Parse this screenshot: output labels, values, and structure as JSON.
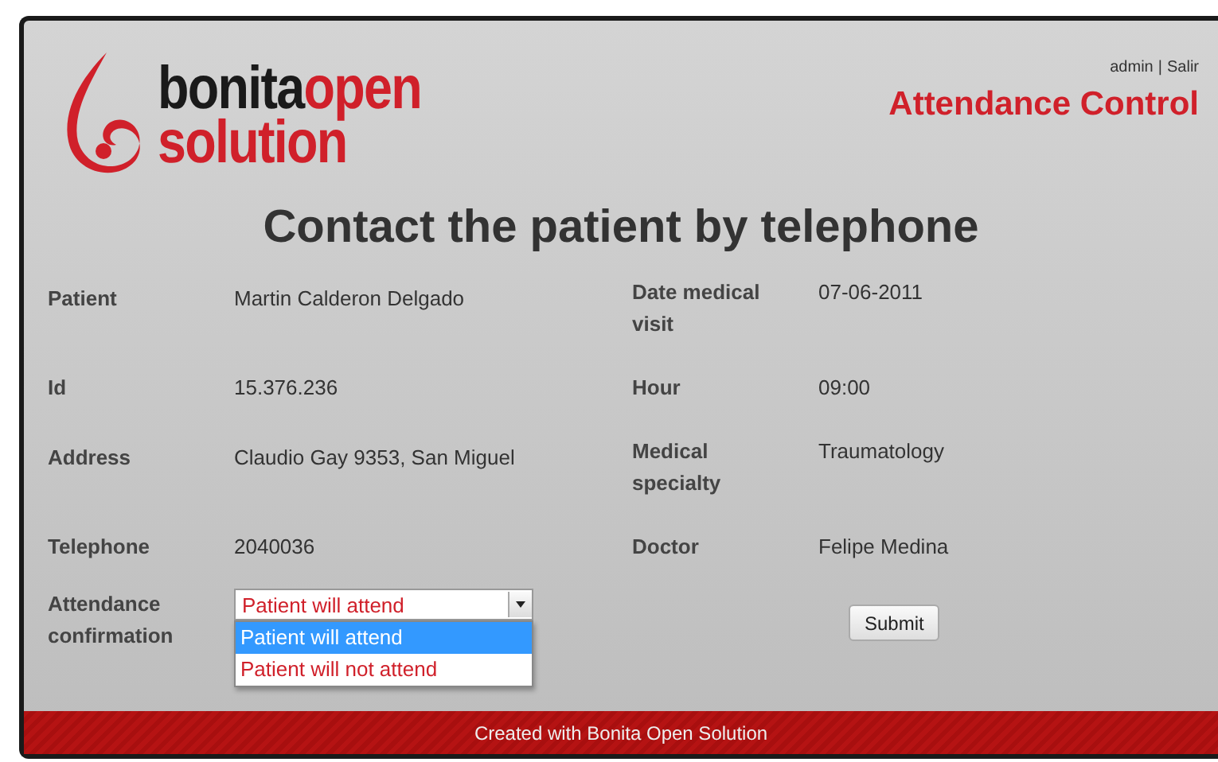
{
  "logo": {
    "word_dark": "bonita",
    "word_red": "open",
    "word_second": "solution"
  },
  "header": {
    "user": "admin",
    "separator": "|",
    "logout": "Salir",
    "app_title": "Attendance Control"
  },
  "form": {
    "title": "Contact the patient by telephone",
    "fields": [
      {
        "label": "Patient",
        "value": "Martin Calderon Delgado"
      },
      {
        "label": "Date medical visit",
        "value": "07-06-2011"
      },
      {
        "label": "Id",
        "value": "15.376.236"
      },
      {
        "label": "Hour",
        "value": "09:00"
      },
      {
        "label": "Address",
        "value": "Claudio Gay 9353, San Miguel"
      },
      {
        "label": "Medical specialty",
        "value": "Traumatology"
      },
      {
        "label": "Telephone",
        "value": "2040036"
      },
      {
        "label": "Doctor",
        "value": "Felipe Medina"
      }
    ],
    "confirmation": {
      "label": "Attendance confirmation",
      "value": "Patient will attend",
      "expanded": true,
      "options": [
        {
          "label": "Patient will attend",
          "selected": true
        },
        {
          "label": "Patient will not attend",
          "selected": false
        }
      ]
    },
    "submit": "Submit"
  },
  "footer": {
    "text": "Created with Bonita Open Solution"
  }
}
